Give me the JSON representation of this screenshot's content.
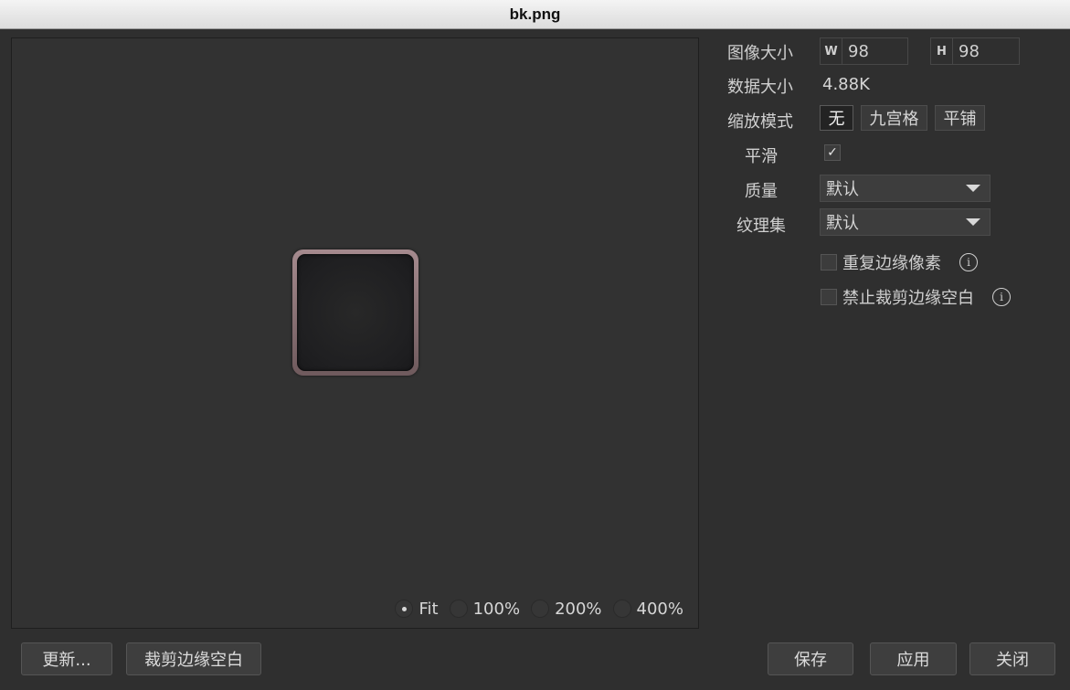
{
  "window": {
    "title": "bk.png"
  },
  "preview": {
    "zoom_options": [
      {
        "label": "Fit",
        "selected": true
      },
      {
        "label": "100%",
        "selected": false
      },
      {
        "label": "200%",
        "selected": false
      },
      {
        "label": "400%",
        "selected": false
      }
    ]
  },
  "props": {
    "image_size_label": "图像大小",
    "width_tag": "W",
    "width_value": "98",
    "height_tag": "H",
    "height_value": "98",
    "data_size_label": "数据大小",
    "data_size_value": "4.88K",
    "scale_mode_label": "缩放模式",
    "scale_modes": [
      {
        "label": "无",
        "active": true
      },
      {
        "label": "九宫格",
        "active": false
      },
      {
        "label": "平铺",
        "active": false
      }
    ],
    "smooth_label": "平滑",
    "smooth_checked": true,
    "smooth_check_glyph": "✓",
    "quality_label": "质量",
    "quality_value": "默认",
    "atlas_label": "纹理集",
    "atlas_value": "默认",
    "repeat_edge_label": "重复边缘像素",
    "no_trim_label": "禁止裁剪边缘空白",
    "info_glyph": "i"
  },
  "buttons": {
    "update": "更新...",
    "trim": "裁剪边缘空白",
    "save": "保存",
    "apply": "应用",
    "close": "关闭"
  },
  "colors": {
    "background": "#2f2f2f",
    "titlebar": "#e6e6e6",
    "thumb_border": "#8f7679"
  }
}
